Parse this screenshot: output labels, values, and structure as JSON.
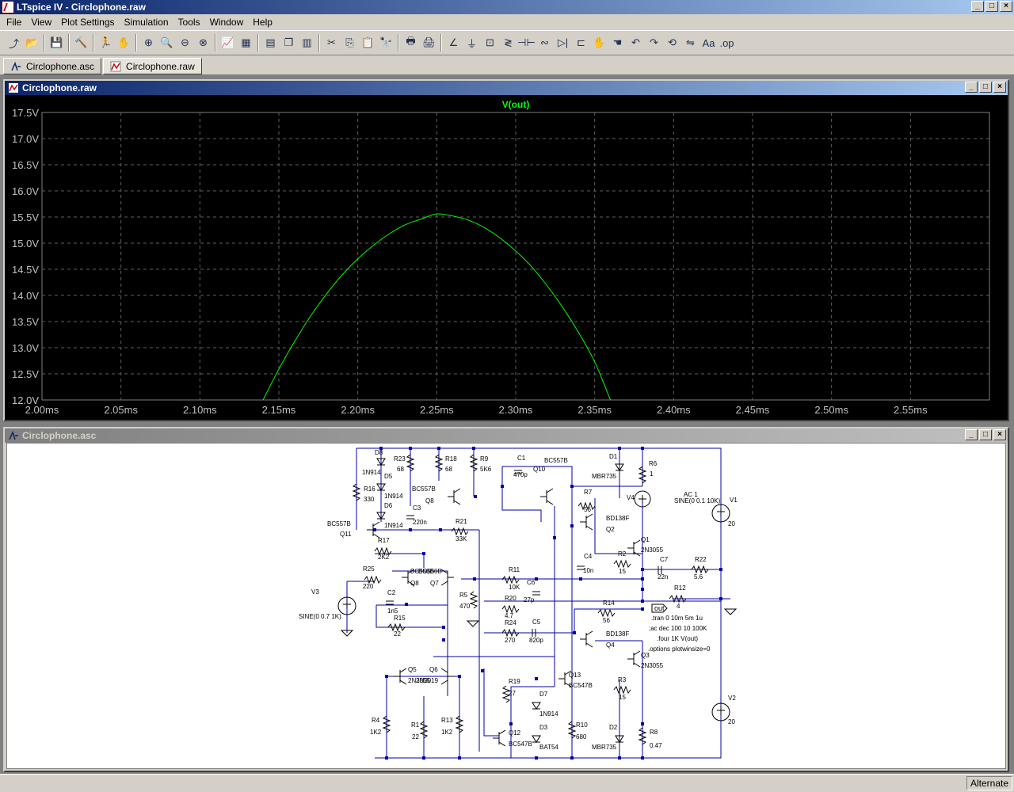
{
  "window": {
    "title": "LTspice IV - Circlophone.raw"
  },
  "winbuttons": {
    "minimize": "_",
    "maximize": "□",
    "close": "×"
  },
  "menu": [
    "File",
    "View",
    "Plot Settings",
    "Simulation",
    "Tools",
    "Window",
    "Help"
  ],
  "toolbar": {
    "groups": [
      [
        "schematic-icon",
        "open-icon"
      ],
      [
        "save-icon"
      ],
      [
        "control-panel-icon"
      ],
      [
        "run-icon",
        "pan-icon"
      ],
      [
        "zoom-in-icon",
        "zoom-area-icon",
        "zoom-out-icon",
        "zoom-fit-icon"
      ],
      [
        "autorange-icon",
        "grid-icon"
      ],
      [
        "tile-horizontal-icon",
        "cascade-icon",
        "tile-vertical-icon"
      ],
      [
        "cut-icon",
        "copy-icon",
        "paste-icon",
        "find-icon"
      ],
      [
        "print-setup-icon",
        "print-icon"
      ],
      [
        "wire-icon",
        "ground-icon",
        "label-icon",
        "resistor-icon",
        "capacitor-icon",
        "inductor-icon",
        "diode-icon",
        "component-icon",
        "move-icon",
        "drag-icon",
        "undo-icon",
        "redo-icon",
        "rotate-icon",
        "mirror-icon",
        "text-icon",
        "spice-directive-icon"
      ]
    ],
    "glyphs": {
      "schematic-icon": "⤴",
      "open-icon": "📂",
      "save-icon": "💾",
      "control-panel-icon": "🔨",
      "run-icon": "🏃",
      "pan-icon": "✋",
      "zoom-in-icon": "⊕",
      "zoom-area-icon": "🔍",
      "zoom-out-icon": "⊖",
      "zoom-fit-icon": "⊗",
      "autorange-icon": "📈",
      "grid-icon": "▦",
      "tile-horizontal-icon": "▤",
      "cascade-icon": "❐",
      "tile-vertical-icon": "▥",
      "cut-icon": "✂",
      "copy-icon": "⎘",
      "paste-icon": "📋",
      "find-icon": "🔭",
      "print-setup-icon": "🖶",
      "print-icon": "🖨",
      "wire-icon": "∠",
      "ground-icon": "⏚",
      "label-icon": "⊡",
      "resistor-icon": "≷",
      "capacitor-icon": "⊣⊢",
      "inductor-icon": "∾",
      "diode-icon": "▷|",
      "component-icon": "⊏",
      "move-icon": "✋",
      "drag-icon": "☚",
      "undo-icon": "↶",
      "redo-icon": "↷",
      "rotate-icon": "⟲",
      "mirror-icon": "⇋",
      "text-icon": "Aa",
      "spice-directive-icon": ".op"
    }
  },
  "tabs": [
    {
      "label": "Circlophone.asc",
      "icon": "schematic-icon",
      "active": false
    },
    {
      "label": "Circlophone.raw",
      "icon": "waveform-icon",
      "active": true
    }
  ],
  "plot_window": {
    "title": "Circlophone.raw"
  },
  "schematic_window": {
    "title": "Circlophone.asc"
  },
  "chart_data": {
    "type": "line",
    "title": "V(out)",
    "xlabel": "",
    "ylabel": "",
    "xlim": [
      2.0,
      2.6
    ],
    "ylim": [
      12.0,
      17.5
    ],
    "x_ticks": [
      "2.00ms",
      "2.05ms",
      "2.10ms",
      "2.15ms",
      "2.20ms",
      "2.25ms",
      "2.30ms",
      "2.35ms",
      "2.40ms",
      "2.45ms",
      "2.50ms",
      "2.55ms"
    ],
    "y_ticks": [
      "12.0V",
      "12.5V",
      "13.0V",
      "13.5V",
      "14.0V",
      "14.5V",
      "15.0V",
      "15.5V",
      "16.0V",
      "16.5V",
      "17.0V",
      "17.5V"
    ],
    "grid": true,
    "series": [
      {
        "name": "V(out)",
        "color": "#00ff00",
        "x": [
          2.14,
          2.15,
          2.16,
          2.17,
          2.18,
          2.19,
          2.2,
          2.21,
          2.22,
          2.23,
          2.24,
          2.25,
          2.26,
          2.27,
          2.28,
          2.29,
          2.3,
          2.31,
          2.32,
          2.33,
          2.34,
          2.35,
          2.36
        ],
        "y": [
          12.0,
          12.59,
          13.12,
          13.6,
          14.02,
          14.39,
          14.7,
          14.96,
          15.18,
          15.35,
          15.46,
          15.56,
          15.52,
          15.44,
          15.3,
          15.1,
          14.85,
          14.55,
          14.18,
          13.76,
          13.28,
          12.73,
          12.0
        ]
      }
    ]
  },
  "schematic": {
    "labels": [
      [
        "D8",
        468,
        575
      ],
      [
        "1N914",
        452,
        600
      ],
      [
        "D5",
        480,
        605
      ],
      [
        "1N914",
        480,
        630
      ],
      [
        "D6",
        480,
        642
      ],
      [
        "1N914",
        480,
        667
      ],
      [
        "R16",
        454,
        621
      ],
      [
        "330",
        454,
        634
      ],
      [
        "BC557B",
        408,
        665
      ],
      [
        "Q11",
        424,
        678
      ],
      [
        "R17",
        472,
        686
      ],
      [
        "2K2",
        472,
        707
      ],
      [
        "R23",
        492,
        583
      ],
      [
        "68",
        496,
        596
      ],
      [
        "BC557B",
        515,
        621
      ],
      [
        "Q8",
        532,
        636
      ],
      [
        "C3",
        516,
        645
      ],
      [
        "220n",
        516,
        663
      ],
      [
        "R18",
        557,
        583
      ],
      [
        "68",
        557,
        596
      ],
      [
        "R9",
        601,
        583
      ],
      [
        "5K6",
        601,
        596
      ],
      [
        "R21",
        570,
        662
      ],
      [
        "33K",
        570,
        684
      ],
      [
        "C1",
        648,
        582
      ],
      [
        "470p",
        643,
        603
      ],
      [
        "Q10",
        668,
        596
      ],
      [
        "BC557B",
        682,
        585
      ],
      [
        "D1",
        764,
        580
      ],
      [
        "MBR735",
        742,
        605
      ],
      [
        "R6",
        814,
        589
      ],
      [
        "1",
        815,
        602
      ],
      [
        "V4",
        786,
        632
      ],
      [
        "SINE(0 0.1 10K)",
        846,
        636
      ],
      [
        "AC 1",
        858,
        628
      ],
      [
        "V1",
        916,
        635
      ],
      [
        "20",
        914,
        665
      ],
      [
        "R7",
        732,
        625
      ],
      [
        "56",
        732,
        647
      ],
      [
        "BD138F",
        760,
        658
      ],
      [
        "Q2",
        760,
        672
      ],
      [
        "Q1",
        804,
        685
      ],
      [
        "2N3055",
        804,
        698
      ],
      [
        "C4",
        732,
        706
      ],
      [
        "10n",
        731,
        724
      ],
      [
        "R2",
        775,
        703
      ],
      [
        "15",
        776,
        725
      ],
      [
        "C7",
        828,
        710
      ],
      [
        "22n",
        825,
        732
      ],
      [
        "R22",
        872,
        710
      ],
      [
        "5.6",
        871,
        732
      ],
      [
        "R25",
        453,
        722
      ],
      [
        "220",
        453,
        744
      ],
      [
        "BC550B",
        513,
        725
      ],
      [
        "BC550B",
        523,
        725
      ],
      [
        "Q8",
        513,
        740
      ],
      [
        "Q7",
        538,
        740
      ],
      [
        "R11",
        637,
        723
      ],
      [
        "10K",
        637,
        745
      ],
      [
        "C6",
        660,
        739
      ],
      [
        "27p",
        656,
        761
      ],
      [
        "R5",
        575,
        755
      ],
      [
        "470",
        575,
        769
      ],
      [
        "V3",
        388,
        751
      ],
      [
        "C2",
        484,
        752
      ],
      [
        "1n5",
        484,
        775
      ],
      [
        "R15",
        492,
        784
      ],
      [
        "22",
        492,
        804
      ],
      [
        "SINE(0 0.7 1K)",
        372,
        782
      ],
      [
        "R20",
        632,
        759
      ],
      [
        "4.7",
        632,
        781
      ],
      [
        "R24",
        632,
        790
      ],
      [
        "270",
        632,
        812
      ],
      [
        "C5",
        667,
        789
      ],
      [
        "820p",
        663,
        812
      ],
      [
        "R12",
        846,
        746
      ],
      [
        "4",
        849,
        769
      ],
      [
        "R14",
        756,
        765
      ],
      [
        "56",
        756,
        787
      ],
      [
        "BD138F",
        760,
        804
      ],
      [
        "Q4",
        760,
        818
      ],
      [
        "Q3",
        804,
        831
      ],
      [
        "2N3055",
        804,
        844
      ],
      [
        ".tran 0 10m 5m 1u",
        817,
        784
      ],
      [
        ";ac dec 100 10 100K",
        814,
        797
      ],
      [
        ".four 1K V(out)",
        824,
        810
      ],
      [
        ".options plotwinsize=0",
        813,
        823
      ],
      [
        "Q5",
        510,
        849
      ],
      [
        "Q6",
        537,
        849
      ],
      [
        "2N3055",
        510,
        863
      ],
      [
        "2N3019",
        520,
        863
      ],
      [
        "Q13",
        713,
        856
      ],
      [
        "BC547B",
        713,
        869
      ],
      [
        "R19",
        637,
        864
      ],
      [
        "27",
        637,
        879
      ],
      [
        "D7",
        676,
        880
      ],
      [
        "1N914",
        676,
        905
      ],
      [
        "R3",
        775,
        862
      ],
      [
        "15",
        776,
        884
      ],
      [
        "V2",
        914,
        885
      ],
      [
        "20",
        914,
        915
      ],
      [
        "R4",
        464,
        913
      ],
      [
        "1K2",
        462,
        928
      ],
      [
        "R1",
        514,
        919
      ],
      [
        "22",
        515,
        934
      ],
      [
        "R13",
        552,
        913
      ],
      [
        "1K2",
        552,
        928
      ],
      [
        "Q12",
        637,
        929
      ],
      [
        "BC547B",
        637,
        943
      ],
      [
        "D3",
        676,
        922
      ],
      [
        "BAT54",
        676,
        947
      ],
      [
        "R10",
        722,
        919
      ],
      [
        "680",
        722,
        934
      ],
      [
        "D2",
        764,
        922
      ],
      [
        "MBR735",
        742,
        947
      ],
      [
        "R8",
        815,
        928
      ],
      [
        "0.47",
        815,
        945
      ]
    ],
    "out_label": "out"
  },
  "status": {
    "mode": "Alternate"
  }
}
